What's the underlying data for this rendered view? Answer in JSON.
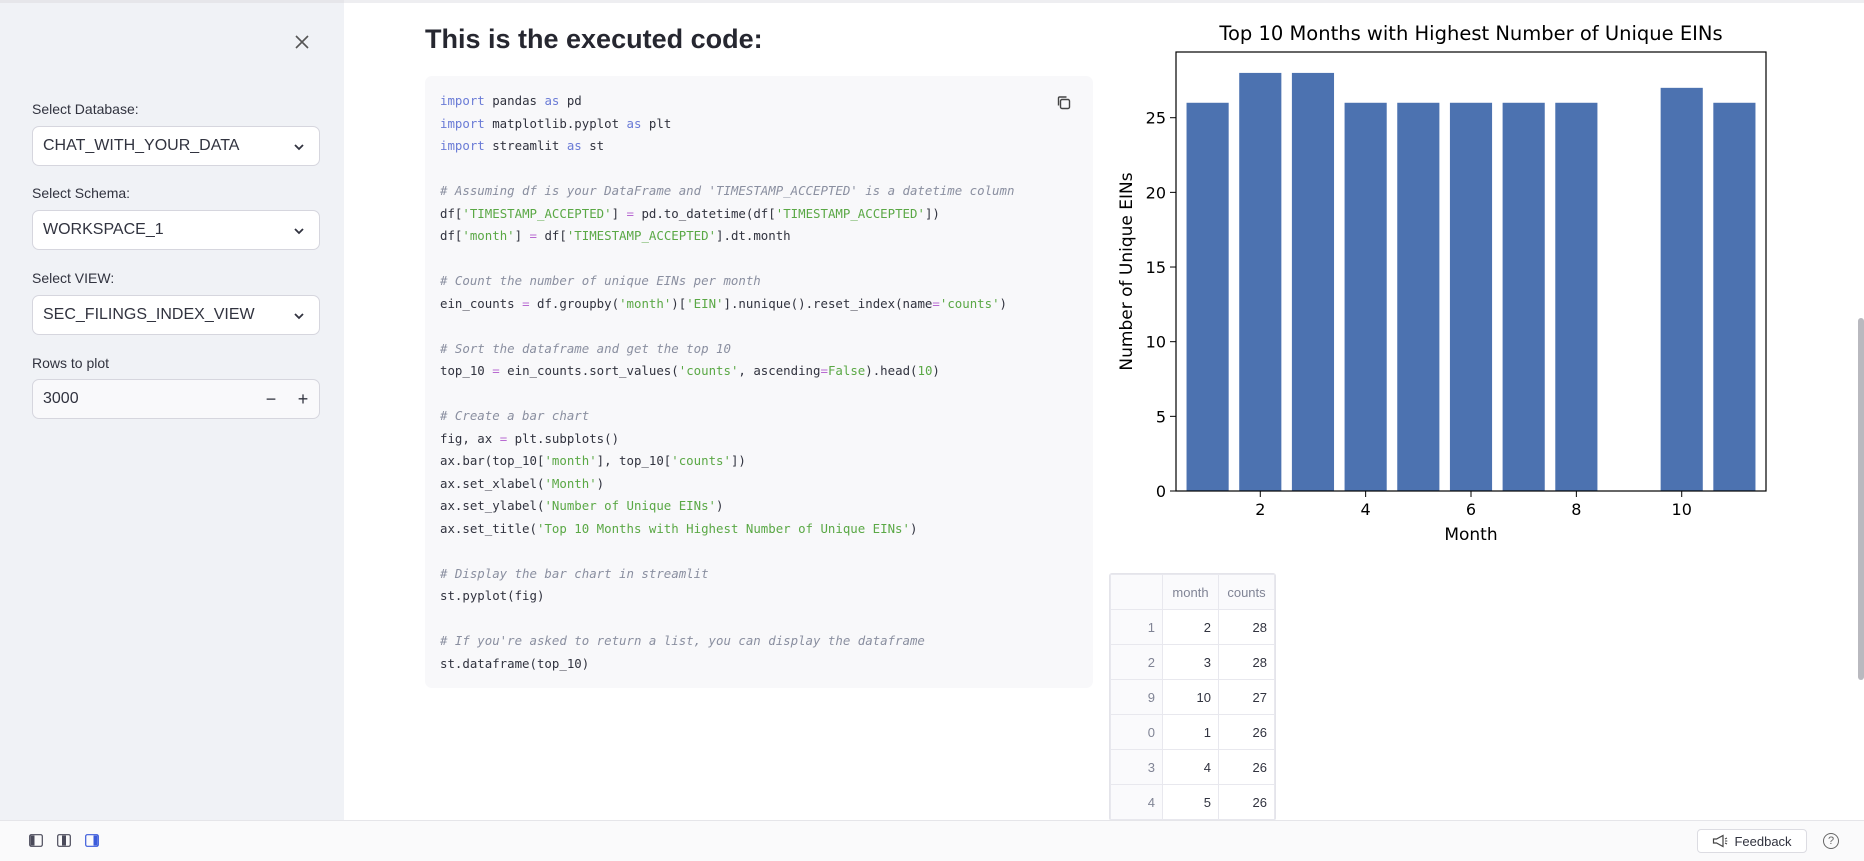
{
  "sidebar": {
    "database_label": "Select Database:",
    "database_value": "CHAT_WITH_YOUR_DATA",
    "schema_label": "Select Schema:",
    "schema_value": "WORKSPACE_1",
    "view_label": "Select VIEW:",
    "view_value": "SEC_FILINGS_INDEX_VIEW",
    "rows_label": "Rows to plot",
    "rows_value": "3000",
    "minus": "−",
    "plus": "+"
  },
  "main": {
    "heading": "This is the executed code:",
    "code": [
      [
        [
          "kw",
          "import"
        ],
        [
          "t",
          " pandas "
        ],
        [
          "kw",
          "as"
        ],
        [
          "t",
          " pd"
        ]
      ],
      [
        [
          "kw",
          "import"
        ],
        [
          "t",
          " matplotlib.pyplot "
        ],
        [
          "kw",
          "as"
        ],
        [
          "t",
          " plt"
        ]
      ],
      [
        [
          "kw",
          "import"
        ],
        [
          "t",
          " streamlit "
        ],
        [
          "kw",
          "as"
        ],
        [
          "t",
          " st"
        ]
      ],
      [],
      [
        [
          "cm",
          "# Assuming df is your DataFrame and 'TIMESTAMP_ACCEPTED' is a datetime column"
        ]
      ],
      [
        [
          "t",
          "df["
        ],
        [
          "st",
          "'TIMESTAMP_ACCEPTED'"
        ],
        [
          "t",
          "] "
        ],
        [
          "op",
          "="
        ],
        [
          "t",
          " pd.to_datetime(df["
        ],
        [
          "st",
          "'TIMESTAMP_ACCEPTED'"
        ],
        [
          "t",
          "])"
        ]
      ],
      [
        [
          "t",
          "df["
        ],
        [
          "st",
          "'month'"
        ],
        [
          "t",
          "] "
        ],
        [
          "op",
          "="
        ],
        [
          "t",
          " df["
        ],
        [
          "st",
          "'TIMESTAMP_ACCEPTED'"
        ],
        [
          "t",
          "].dt.month"
        ]
      ],
      [],
      [
        [
          "cm",
          "# Count the number of unique EINs per month"
        ]
      ],
      [
        [
          "t",
          "ein_counts "
        ],
        [
          "op",
          "="
        ],
        [
          "t",
          " df.groupby("
        ],
        [
          "st",
          "'month'"
        ],
        [
          "t",
          ")["
        ],
        [
          "st",
          "'EIN'"
        ],
        [
          "t",
          "].nunique().reset_index(name"
        ],
        [
          "op",
          "="
        ],
        [
          "st",
          "'counts'"
        ],
        [
          "t",
          ")"
        ]
      ],
      [],
      [
        [
          "cm",
          "# Sort the dataframe and get the top 10"
        ]
      ],
      [
        [
          "t",
          "top_10 "
        ],
        [
          "op",
          "="
        ],
        [
          "t",
          " ein_counts.sort_values("
        ],
        [
          "st",
          "'counts'"
        ],
        [
          "t",
          ", ascending"
        ],
        [
          "op",
          "="
        ],
        [
          "nm",
          "False"
        ],
        [
          "t",
          ").head("
        ],
        [
          "nm",
          "10"
        ],
        [
          "t",
          ")"
        ]
      ],
      [],
      [
        [
          "cm",
          "# Create a bar chart"
        ]
      ],
      [
        [
          "t",
          "fig, ax "
        ],
        [
          "op",
          "="
        ],
        [
          "t",
          " plt.subplots()"
        ]
      ],
      [
        [
          "t",
          "ax.bar(top_10["
        ],
        [
          "st",
          "'month'"
        ],
        [
          "t",
          "], top_10["
        ],
        [
          "st",
          "'counts'"
        ],
        [
          "t",
          "])"
        ]
      ],
      [
        [
          "t",
          "ax.set_xlabel("
        ],
        [
          "st",
          "'Month'"
        ],
        [
          "t",
          ")"
        ]
      ],
      [
        [
          "t",
          "ax.set_ylabel("
        ],
        [
          "st",
          "'Number of Unique EINs'"
        ],
        [
          "t",
          ")"
        ]
      ],
      [
        [
          "t",
          "ax.set_title("
        ],
        [
          "st",
          "'Top 10 Months with Highest Number of Unique EINs'"
        ],
        [
          "t",
          ")"
        ]
      ],
      [],
      [
        [
          "cm",
          "# Display the bar chart in streamlit"
        ]
      ],
      [
        [
          "t",
          "st.pyplot(fig)"
        ]
      ],
      [],
      [
        [
          "cm",
          "# If you're asked to return a list, you can display the dataframe"
        ]
      ],
      [
        [
          "t",
          "st.dataframe(top_10)"
        ]
      ]
    ]
  },
  "chart_data": {
    "type": "bar",
    "title": "Top 10 Months with Highest Number of Unique EINs",
    "xlabel": "Month",
    "ylabel": "Number of Unique EINs",
    "x": [
      1,
      2,
      3,
      4,
      5,
      6,
      7,
      8,
      10,
      11
    ],
    "values": [
      26,
      28,
      28,
      26,
      26,
      26,
      26,
      26,
      27,
      26
    ],
    "xlim": [
      0.4,
      11.6
    ],
    "ylim": [
      0,
      29.4
    ],
    "xticks": [
      2,
      4,
      6,
      8,
      10
    ],
    "yticks": [
      0,
      5,
      10,
      15,
      20,
      25
    ],
    "bar_color": "#4c72b0",
    "grid": false
  },
  "table": {
    "columns": [
      "",
      "month",
      "counts"
    ],
    "rows": [
      [
        "1",
        "2",
        "28"
      ],
      [
        "2",
        "3",
        "28"
      ],
      [
        "9",
        "10",
        "27"
      ],
      [
        "0",
        "1",
        "26"
      ],
      [
        "3",
        "4",
        "26"
      ],
      [
        "4",
        "5",
        "26"
      ]
    ]
  },
  "bottombar": {
    "feedback_label": "Feedback",
    "help": "?"
  },
  "icons": {
    "close": "close-icon",
    "chevron": "chevron-down-icon",
    "copy": "copy-icon",
    "feedback": "megaphone-icon"
  }
}
